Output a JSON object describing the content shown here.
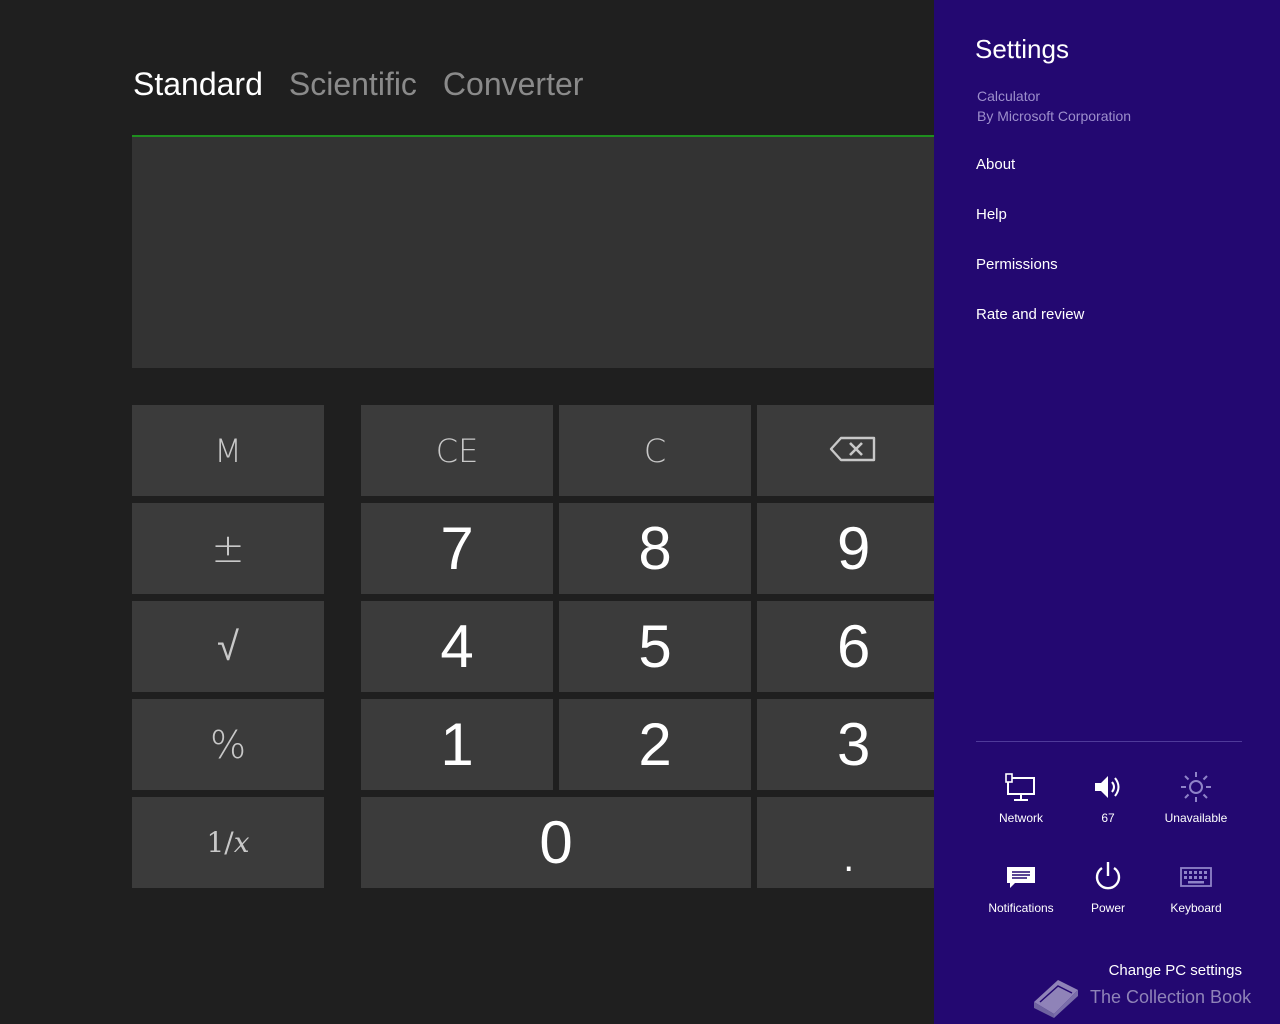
{
  "calculator": {
    "tabs": [
      {
        "label": "Standard",
        "active": true
      },
      {
        "label": "Scientific",
        "active": false
      },
      {
        "label": "Converter",
        "active": false
      }
    ],
    "display_value": "",
    "accent_color": "#1e8f1e",
    "keys": {
      "memory": "M",
      "clear_entry": "CE",
      "clear": "C",
      "backspace_icon": "backspace-icon",
      "negate": "±",
      "sqrt": "√",
      "percent": "%",
      "reciprocal": "1/x",
      "d7": "7",
      "d8": "8",
      "d9": "9",
      "d4": "4",
      "d5": "5",
      "d6": "6",
      "d1": "1",
      "d2": "2",
      "d3": "3",
      "d0": "0",
      "decimal": "."
    }
  },
  "settings_charm": {
    "title": "Settings",
    "app_name": "Calculator",
    "app_publisher": "By Microsoft Corporation",
    "links": [
      "About",
      "Help",
      "Permissions",
      "Rate and review"
    ],
    "background_color": "#230871",
    "quick_tiles": [
      {
        "icon": "network-icon",
        "label": "Network"
      },
      {
        "icon": "volume-icon",
        "label": "67"
      },
      {
        "icon": "brightness-icon",
        "label": "Unavailable"
      },
      {
        "icon": "notifications-icon",
        "label": "Notifications"
      },
      {
        "icon": "power-icon",
        "label": "Power"
      },
      {
        "icon": "keyboard-icon",
        "label": "Keyboard"
      }
    ],
    "change_pc_settings": "Change PC settings"
  },
  "watermark": {
    "text": "The Collection Book",
    "icon": "book-icon"
  }
}
